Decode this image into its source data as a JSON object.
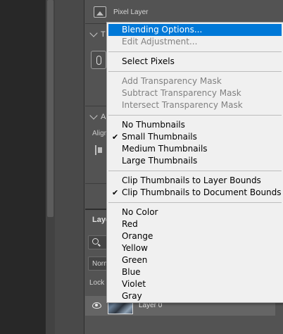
{
  "properties_panel": {
    "layer_type_label": "Pixel Layer",
    "section_transform_initial": "T",
    "section_align_initial": "A",
    "align_label": "Align"
  },
  "layers_panel": {
    "tab_label": "Layers",
    "blend_mode_value": "Normal",
    "lock_label": "Lock",
    "layer_name": "Layer 0"
  },
  "context_menu": {
    "groups": [
      [
        {
          "label": "Blending Options...",
          "disabled": false,
          "checked": false,
          "highlighted": true
        },
        {
          "label": "Edit Adjustment...",
          "disabled": true,
          "checked": false,
          "highlighted": false
        }
      ],
      [
        {
          "label": "Select Pixels",
          "disabled": false,
          "checked": false,
          "highlighted": false
        }
      ],
      [
        {
          "label": "Add Transparency Mask",
          "disabled": true,
          "checked": false,
          "highlighted": false
        },
        {
          "label": "Subtract Transparency Mask",
          "disabled": true,
          "checked": false,
          "highlighted": false
        },
        {
          "label": "Intersect Transparency Mask",
          "disabled": true,
          "checked": false,
          "highlighted": false
        }
      ],
      [
        {
          "label": "No Thumbnails",
          "disabled": false,
          "checked": false,
          "highlighted": false
        },
        {
          "label": "Small Thumbnails",
          "disabled": false,
          "checked": true,
          "highlighted": false
        },
        {
          "label": "Medium Thumbnails",
          "disabled": false,
          "checked": false,
          "highlighted": false
        },
        {
          "label": "Large Thumbnails",
          "disabled": false,
          "checked": false,
          "highlighted": false
        }
      ],
      [
        {
          "label": "Clip Thumbnails to Layer Bounds",
          "disabled": false,
          "checked": false,
          "highlighted": false
        },
        {
          "label": "Clip Thumbnails to Document Bounds",
          "disabled": false,
          "checked": true,
          "highlighted": false
        }
      ],
      [
        {
          "label": "No Color",
          "disabled": false,
          "checked": false,
          "highlighted": false
        },
        {
          "label": "Red",
          "disabled": false,
          "checked": false,
          "highlighted": false
        },
        {
          "label": "Orange",
          "disabled": false,
          "checked": false,
          "highlighted": false
        },
        {
          "label": "Yellow",
          "disabled": false,
          "checked": false,
          "highlighted": false
        },
        {
          "label": "Green",
          "disabled": false,
          "checked": false,
          "highlighted": false
        },
        {
          "label": "Blue",
          "disabled": false,
          "checked": false,
          "highlighted": false
        },
        {
          "label": "Violet",
          "disabled": false,
          "checked": false,
          "highlighted": false
        },
        {
          "label": "Gray",
          "disabled": false,
          "checked": false,
          "highlighted": false
        }
      ]
    ],
    "check_glyph": "✔"
  },
  "colors": {
    "menu_highlight": "#0078d7",
    "menu_background": "#f0f0f0",
    "panel_background": "#535353"
  }
}
